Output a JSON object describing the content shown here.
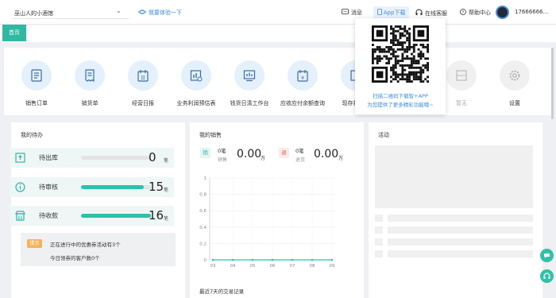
{
  "header": {
    "store_name": "巫山人的小酒馆",
    "try_link": "我要体验一下",
    "messages": "消息",
    "app_download": "App下载",
    "online_service": "在线客服",
    "help_center": "帮助中心",
    "username": "17666666..."
  },
  "tabs": {
    "home": "首页"
  },
  "quick_icons": [
    {
      "label": "销售订单",
      "icon": "sales-order-icon"
    },
    {
      "label": "销货单",
      "icon": "sales-receipt-icon"
    },
    {
      "label": "经营日报",
      "icon": "daily-report-icon"
    },
    {
      "label": "业务利润预估表",
      "icon": "profit-estimate-icon"
    },
    {
      "label": "钱货日清工作台",
      "icon": "daily-clearing-icon"
    },
    {
      "label": "应收应付余额查询",
      "icon": "balance-query-icon"
    },
    {
      "label": "现存量（库",
      "icon": "inventory-icon"
    },
    {
      "label": "",
      "icon": "hidden-icon"
    },
    {
      "label": "暂无",
      "icon": "placeholder-icon"
    },
    {
      "label": "设置",
      "icon": "gear-icon"
    }
  ],
  "qr_popup": {
    "line1": "扫描二维码下载智+APP",
    "line2": "为您提供了更多精彩功能哦~"
  },
  "todo": {
    "title": "我的待办",
    "items": [
      {
        "label": "待出库",
        "value": "0",
        "unit": "笔",
        "progress": 0
      },
      {
        "label": "待审核",
        "value": "15",
        "unit": "笔",
        "progress": 0.9
      },
      {
        "label": "待收款",
        "value": "16",
        "unit": "笔",
        "progress": 1.0
      }
    ],
    "notice_tag": "提示",
    "notice_line1": "正在进行中的优惠券活动有3个",
    "notice_line2": "今日领券的客户数0个"
  },
  "sales": {
    "title": "我的销售",
    "sell_badge": "销",
    "sell_count": "0笔",
    "sell_sub": "销售",
    "sell_amount": "0.00",
    "sell_unit": "万",
    "return_badge": "退",
    "return_count": "0笔",
    "return_sub": "退货",
    "return_amount": "0.00",
    "return_unit": "万",
    "footer": "最近7天的交易记录"
  },
  "activity": {
    "title": "活动"
  },
  "chart_data": {
    "type": "line",
    "categories": [
      "03",
      "04",
      "05",
      "06",
      "07",
      "08",
      "09"
    ],
    "values": [
      0,
      0,
      0,
      0,
      0,
      0,
      0
    ],
    "yticks": [
      "0",
      "0.2",
      "0.4",
      "0.6",
      "0.8",
      "1"
    ],
    "ylim": [
      0,
      1
    ],
    "colors": {
      "line": "#2fc1a7"
    }
  },
  "colors": {
    "accent": "#2fb9a3",
    "link": "#3a8ee6"
  }
}
